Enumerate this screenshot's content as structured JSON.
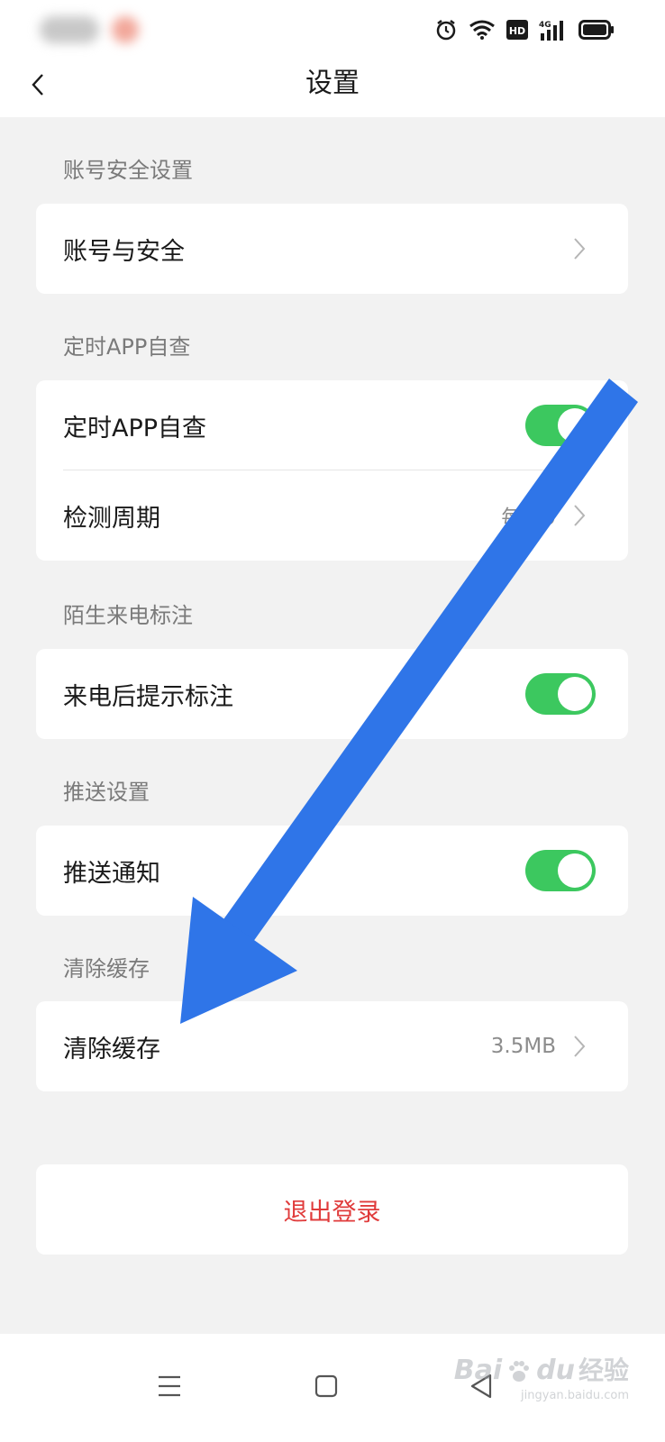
{
  "navbar": {
    "title": "设置"
  },
  "sections": [
    {
      "title": "账号安全设置",
      "rows": [
        {
          "label": "账号与安全",
          "type": "chevron"
        }
      ]
    },
    {
      "title": "定时APP自查",
      "rows": [
        {
          "label": "定时APP自查",
          "type": "toggle",
          "on": true
        },
        {
          "label": "检测周期",
          "type": "chevron",
          "value": "每天9"
        }
      ]
    },
    {
      "title": "陌生来电标注",
      "rows": [
        {
          "label": "来电后提示标注",
          "type": "toggle",
          "on": true
        }
      ]
    },
    {
      "title": "推送设置",
      "rows": [
        {
          "label": "推送通知",
          "type": "toggle",
          "on": true
        }
      ]
    },
    {
      "title": "清除缓存",
      "rows": [
        {
          "label": "清除缓存",
          "type": "chevron",
          "value": "3.5MB"
        }
      ]
    }
  ],
  "logout": {
    "label": "退出登录"
  },
  "status_icons": [
    "alarm-icon",
    "wifi-icon",
    "hd-icon",
    "signal-4g-icon",
    "battery-icon"
  ],
  "status_labels": {
    "hd": "HD",
    "net": "4G"
  },
  "bottom_nav": [
    "menu-icon",
    "home-square-icon",
    "back-triangle-icon"
  ],
  "watermark": {
    "brand": "Bai",
    "brand_suffix": "du",
    "cn": "经验",
    "url": "jingyan.baidu.com"
  },
  "colors": {
    "toggle_on": "#3cc85f",
    "logout": "#e03b3b",
    "arrow": "#2f75e8",
    "background": "#f2f2f2"
  }
}
